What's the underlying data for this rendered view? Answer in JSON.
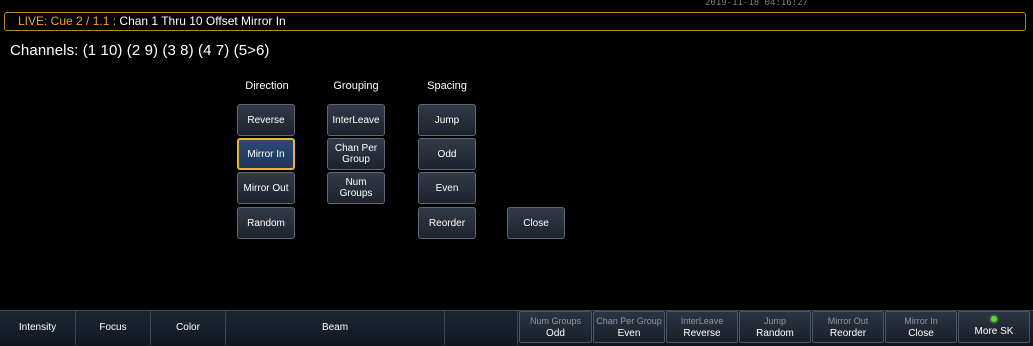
{
  "header": {
    "clock": "2019-11-18 04:16:27",
    "live_label": "LIVE: Cue  2 / 1.1 :",
    "cue_title": "Chan 1 Thru 10 Offset Mirror In"
  },
  "channels_text": "Channels: (1  10) (2  9) (3  8) (4  7) (5>6)",
  "columns": {
    "direction": {
      "label": "Direction",
      "buttons": [
        "Reverse",
        "Mirror In",
        "Mirror Out",
        "Random"
      ]
    },
    "grouping": {
      "label": "Grouping",
      "buttons": [
        "InterLeave",
        "Chan Per Group",
        "Num Groups"
      ]
    },
    "spacing": {
      "label": "Spacing",
      "buttons": [
        "Jump",
        "Odd",
        "Even",
        "Reorder"
      ]
    }
  },
  "close_label": "Close",
  "selected_button": "Mirror In",
  "softkeys_left": [
    "Intensity",
    "Focus",
    "Color",
    "Beam",
    ""
  ],
  "softkeys_right": [
    {
      "top": "Num Groups",
      "bottom": "Odd"
    },
    {
      "top": "Chan Per Group",
      "bottom": "Even"
    },
    {
      "top": "InterLeave",
      "bottom": "Reverse"
    },
    {
      "top": "Jump",
      "bottom": "Random"
    },
    {
      "top": "Mirror Out",
      "bottom": "Reorder"
    },
    {
      "top": "Mirror In",
      "bottom": "Close"
    },
    {
      "top": "",
      "bottom": "More SK"
    }
  ],
  "colors": {
    "live_accent": "#e9a830",
    "selected_border": "#e7b33c",
    "led": "#5cdb2b"
  }
}
